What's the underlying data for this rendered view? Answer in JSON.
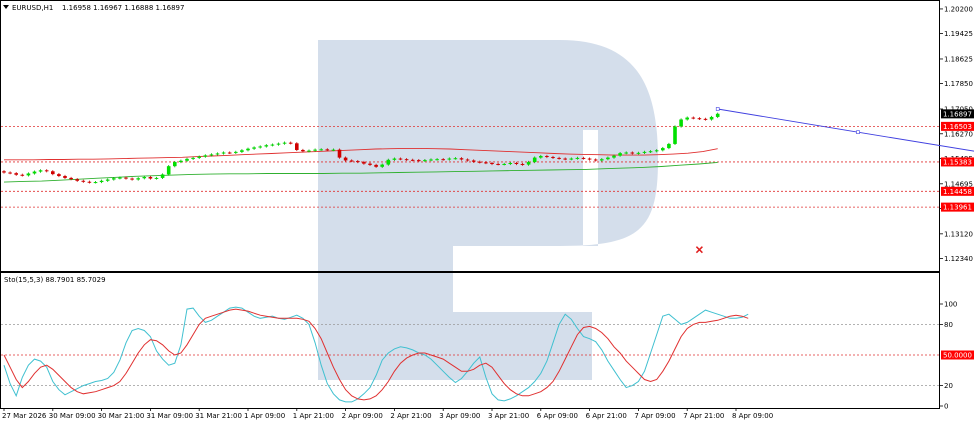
{
  "header": {
    "symbol": "EURUSD,H1",
    "ohlc": "1.16958 1.16967 1.16888 1.16897",
    "triangle_icon": "triangle-down-icon"
  },
  "watermark": {
    "shape": "letter-R",
    "color": "#c9d5e6"
  },
  "price_axis": {
    "labels": [
      "1.20200",
      "1.19425",
      "1.18625",
      "1.17850",
      "1.17050",
      "1.16270",
      "1.15495",
      "1.14695",
      "1.13920",
      "1.13120",
      "1.12340"
    ],
    "levels": [
      1.202,
      1.19425,
      1.18625,
      1.1785,
      1.1705,
      1.1627,
      1.15495,
      1.14695,
      1.1392,
      1.1312,
      1.1234
    ]
  },
  "price_markers": [
    {
      "label": "1.16897",
      "value": 1.16897,
      "bg": "#000000",
      "fg": "#ffffff"
    },
    {
      "label": "1.16503",
      "value": 1.16503,
      "bg": "#ff0000",
      "fg": "#ffffff"
    },
    {
      "label": "1.15383",
      "value": 1.15383,
      "bg": "#ff0000",
      "fg": "#ffffff"
    },
    {
      "label": "1.14458",
      "value": 1.14458,
      "bg": "#ff0000",
      "fg": "#ffffff"
    },
    {
      "label": "1.13961",
      "value": 1.13961,
      "bg": "#ff0000",
      "fg": "#ffffff"
    }
  ],
  "sub_window": {
    "label": "Sto(15,5,3) 88.7901 85.7029",
    "axis_labels": [
      "100",
      "80",
      "50.0000",
      "20",
      "0"
    ],
    "levels": [
      100,
      80,
      50,
      20,
      0
    ],
    "level_50_tag": {
      "label": "50.0000",
      "bg": "#ff0000",
      "fg": "#ffffff"
    }
  },
  "time_axis": {
    "labels": [
      "27 Mar 2026",
      "30 Mar 09:00",
      "30 Mar 21:00",
      "31 Mar 09:00",
      "31 Mar 21:00",
      "1 Apr 09:00",
      "1 Apr 21:00",
      "2 Apr 09:00",
      "2 Apr 21:00",
      "3 Apr 09:00",
      "3 Apr 21:00",
      "6 Apr 09:00",
      "6 Apr 21:00",
      "7 Apr 09:00",
      "7 Apr 21:00",
      "8 Apr 09:00"
    ]
  },
  "chart_data": {
    "type": "candlestick",
    "main": {
      "ylim": [
        1.1195,
        1.2045
      ],
      "close": [
        1.1505,
        1.1503,
        1.1498,
        1.1496,
        1.1502,
        1.1508,
        1.1512,
        1.1509,
        1.15,
        1.1494,
        1.1488,
        1.1484,
        1.1479,
        1.1476,
        1.1474,
        1.1475,
        1.1479,
        1.1483,
        1.1487,
        1.1489,
        1.1486,
        1.1483,
        1.1487,
        1.1491,
        1.1486,
        1.1488,
        1.1499,
        1.1525,
        1.1538,
        1.1542,
        1.1548,
        1.1551,
        1.1555,
        1.1559,
        1.1562,
        1.1565,
        1.1568,
        1.1567,
        1.157,
        1.1575,
        1.158,
        1.1584,
        1.1587,
        1.1591,
        1.1593,
        1.1596,
        1.1599,
        1.1597,
        1.1576,
        1.1572,
        1.1574,
        1.1577,
        1.1578,
        1.1576,
        1.1577,
        1.1552,
        1.1543,
        1.1541,
        1.1538,
        1.1533,
        1.1529,
        1.1523,
        1.153,
        1.1545,
        1.1549,
        1.1547,
        1.1545,
        1.1544,
        1.1542,
        1.1544,
        1.1546,
        1.1547,
        1.1546,
        1.1549,
        1.155,
        1.1546,
        1.1543,
        1.1539,
        1.1537,
        1.1535,
        1.1532,
        1.1531,
        1.1532,
        1.1535,
        1.1532,
        1.153,
        1.1538,
        1.1552,
        1.1557,
        1.1554,
        1.1551,
        1.1549,
        1.1547,
        1.1549,
        1.1551,
        1.1549,
        1.1546,
        1.1543,
        1.1547,
        1.1552,
        1.1558,
        1.1566,
        1.1568,
        1.1565,
        1.1567,
        1.157,
        1.1572,
        1.1575,
        1.1582,
        1.1595,
        1.165,
        1.1672,
        1.1678,
        1.1676,
        1.1674,
        1.1672,
        1.168,
        1.169
      ],
      "ma_red": [
        1.1545,
        1.1545,
        1.1545,
        1.1546,
        1.1546,
        1.1547,
        1.1547,
        1.1548,
        1.1549,
        1.155,
        1.1551,
        1.1552,
        1.1553,
        1.1555,
        1.1557,
        1.1559,
        1.1561,
        1.1563,
        1.1565,
        1.1567,
        1.1569,
        1.1571,
        1.1573,
        1.1575,
        1.1577,
        1.1579,
        1.158,
        1.1581,
        1.1581,
        1.158,
        1.1579,
        1.1577,
        1.1575,
        1.1573,
        1.1571,
        1.1569,
        1.1567,
        1.1565,
        1.1563,
        1.1562,
        1.1561,
        1.156,
        1.156,
        1.156,
        1.1561,
        1.1563,
        1.1566,
        1.1571,
        1.158
      ],
      "ma_green": [
        1.1475,
        1.1477,
        1.1478,
        1.1481,
        1.1484,
        1.1487,
        1.149,
        1.1493,
        1.1495,
        1.1497,
        1.1499,
        1.15,
        1.1501,
        1.1501,
        1.1502,
        1.1502,
        1.1502,
        1.1502,
        1.1503,
        1.1503,
        1.1504,
        1.1505,
        1.1506,
        1.1507,
        1.1508,
        1.1509,
        1.151,
        1.1511,
        1.1512,
        1.1513,
        1.1514,
        1.1515,
        1.1517,
        1.1519,
        1.1521,
        1.1524,
        1.1528,
        1.1532,
        1.1537
      ],
      "forecast": [
        {
          "i": 117,
          "v": 1.1705
        },
        {
          "i": 140,
          "v": 1.1632
        },
        {
          "i": 163,
          "v": 1.156
        }
      ],
      "levels": [
        1.16503,
        1.15383,
        1.14458,
        1.13961
      ],
      "x_mark": {
        "i": 114,
        "v": 1.1262
      }
    },
    "stochastic": {
      "name": "Sto(15,5,3)",
      "ylim": [
        0,
        100
      ],
      "main_line": [
        40,
        22,
        10,
        28,
        40,
        46,
        44,
        38,
        24,
        16,
        11,
        14,
        17,
        20,
        22,
        24,
        25,
        27,
        33,
        45,
        62,
        74,
        76,
        74,
        68,
        54,
        46,
        40,
        42,
        60,
        95,
        96,
        88,
        82,
        84,
        88,
        92,
        96,
        97,
        96,
        92,
        88,
        86,
        87,
        88,
        86,
        85,
        87,
        89,
        86,
        80,
        62,
        40,
        22,
        12,
        6,
        4,
        4,
        7,
        12,
        18,
        30,
        45,
        52,
        56,
        58,
        57,
        55,
        52,
        50,
        46,
        40,
        34,
        28,
        23,
        27,
        34,
        42,
        48,
        28,
        12,
        6,
        5,
        7,
        10,
        14,
        18,
        24,
        32,
        44,
        62,
        80,
        90,
        85,
        76,
        68,
        66,
        63,
        55,
        44,
        35,
        26,
        18,
        20,
        24,
        34,
        52,
        70,
        88,
        90,
        85,
        80,
        82,
        86,
        90,
        94,
        92,
        90,
        88,
        86,
        86,
        87,
        90
      ],
      "signal_line": [
        50,
        38,
        26,
        18,
        24,
        32,
        38,
        40,
        36,
        30,
        24,
        18,
        14,
        12,
        13,
        14,
        16,
        18,
        20,
        24,
        32,
        42,
        52,
        60,
        65,
        64,
        60,
        54,
        50,
        52,
        60,
        70,
        80,
        86,
        88,
        90,
        92,
        94,
        95,
        94,
        93,
        91,
        89,
        88,
        87,
        86,
        86,
        86,
        86,
        85,
        83,
        76,
        66,
        52,
        38,
        26,
        16,
        10,
        7,
        6,
        7,
        10,
        16,
        24,
        34,
        42,
        47,
        50,
        52,
        52,
        50,
        48,
        46,
        42,
        38,
        34,
        34,
        36,
        40,
        42,
        38,
        30,
        22,
        16,
        12,
        10,
        10,
        12,
        14,
        18,
        24,
        34,
        46,
        58,
        70,
        77,
        78,
        76,
        72,
        66,
        58,
        52,
        44,
        38,
        32,
        26,
        24,
        26,
        34,
        44,
        56,
        68,
        76,
        80,
        82,
        82,
        83,
        84,
        86,
        88,
        89,
        88,
        86
      ]
    }
  }
}
